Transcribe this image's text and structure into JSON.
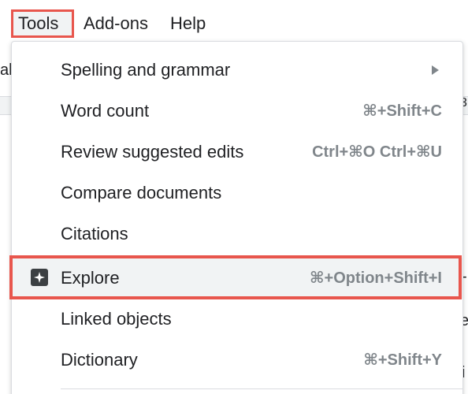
{
  "menubar": {
    "tools": "Tools",
    "addons": "Add-ons",
    "help": "Help"
  },
  "doc_fragments": {
    "left_top": "al",
    "ruler_right": "3",
    "right_1": "-",
    "right_2": "e,",
    "right_3": "i"
  },
  "menu": {
    "items": [
      {
        "label": "Spelling and grammar",
        "shortcut": "",
        "submenu": true
      },
      {
        "label": "Word count",
        "shortcut": "⌘+Shift+C"
      },
      {
        "label": "Review suggested edits",
        "shortcut": "Ctrl+⌘O Ctrl+⌘U"
      },
      {
        "label": "Compare documents",
        "shortcut": ""
      },
      {
        "label": "Citations",
        "shortcut": ""
      },
      {
        "label": "Explore",
        "shortcut": "⌘+Option+Shift+I",
        "icon": "explore-icon",
        "highlighted": true
      },
      {
        "label": "Linked objects",
        "shortcut": ""
      },
      {
        "label": "Dictionary",
        "shortcut": "⌘+Shift+Y"
      }
    ]
  },
  "colors": {
    "highlight_border": "#e8564d",
    "text": "#202124",
    "shortcut": "#80868b",
    "hover_bg": "#f1f3f4"
  }
}
